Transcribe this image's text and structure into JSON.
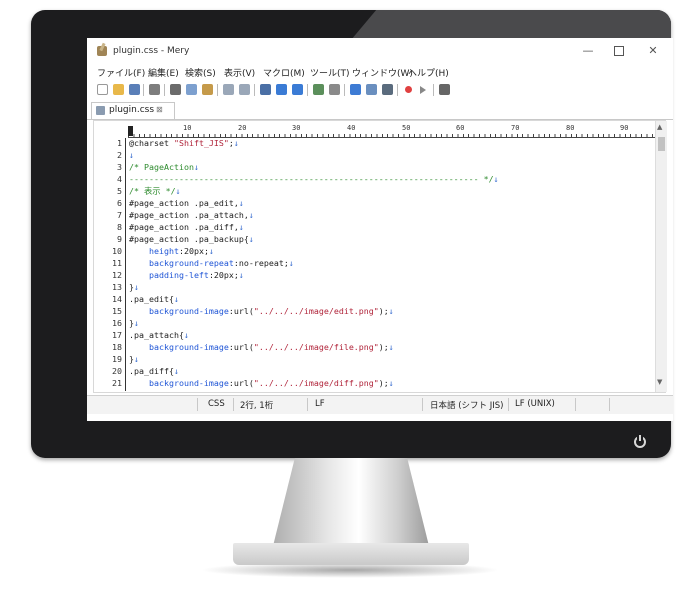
{
  "window": {
    "title": "plugin.css - Mery",
    "min_glyph": "—",
    "close_glyph": "✕"
  },
  "menu": [
    {
      "label": "ファイル(F)"
    },
    {
      "label": "編集(E)"
    },
    {
      "label": "検索(S)"
    },
    {
      "label": "表示(V)"
    },
    {
      "label": "マクロ(M)"
    },
    {
      "label": "ツール(T)"
    },
    {
      "label": "ウィンドウ(W)"
    },
    {
      "label": "ヘルプ(H)"
    }
  ],
  "toolbar": {
    "icons": [
      {
        "name": "new-file-icon",
        "color": "#ffffff"
      },
      {
        "name": "open-folder-icon",
        "color": "#e8b84a"
      },
      {
        "name": "save-icon",
        "color": "#5a7fb8"
      },
      {
        "name": "print-icon",
        "color": "#7d7d7d"
      },
      {
        "name": "cut-icon",
        "color": "#6b6b6b"
      },
      {
        "name": "copy-icon",
        "color": "#7da0cf"
      },
      {
        "name": "paste-icon",
        "color": "#c59a4a"
      },
      {
        "name": "undo-icon",
        "color": "#9aa7b8"
      },
      {
        "name": "redo-icon",
        "color": "#9aa7b8"
      },
      {
        "name": "find-icon",
        "color": "#4a6fa5"
      },
      {
        "name": "find-up-icon",
        "color": "#3a7bd5"
      },
      {
        "name": "find-down-icon",
        "color": "#3a7bd5"
      },
      {
        "name": "replace-icon",
        "color": "#5b8f5b"
      },
      {
        "name": "zoom-icon",
        "color": "#8a8a8a"
      },
      {
        "name": "wrap-icon",
        "color": "#3d7bd4"
      },
      {
        "name": "view-icon",
        "color": "#6a8fbf"
      },
      {
        "name": "panel-icon",
        "color": "#5a6b7d"
      },
      {
        "name": "record-macro-icon",
        "color": "#e04040"
      },
      {
        "name": "play-macro-icon",
        "color": "#888888"
      },
      {
        "name": "settings-icon",
        "color": "#666666"
      }
    ]
  },
  "tab": {
    "label": "plugin.css",
    "close": "⊠"
  },
  "ruler": {
    "marks": [
      "10",
      "20",
      "30",
      "40",
      "50",
      "60",
      "70",
      "80",
      "90"
    ]
  },
  "editor": {
    "lines": [
      {
        "num": "1",
        "tokens": [
          {
            "t": "@charset ",
            "c": "def"
          },
          {
            "t": "\"Shift_JIS\"",
            "c": "str"
          },
          {
            "t": ";",
            "c": "def"
          },
          {
            "t": "↓",
            "c": "mark"
          }
        ]
      },
      {
        "num": "2",
        "tokens": [
          {
            "t": "↓",
            "c": "mark"
          }
        ]
      },
      {
        "num": "3",
        "tokens": [
          {
            "t": "/* PageAction",
            "c": "com"
          },
          {
            "t": "↓",
            "c": "mark"
          }
        ]
      },
      {
        "num": "4",
        "tokens": [
          {
            "t": "---------------------------------------------------------------------- */",
            "c": "com"
          },
          {
            "t": "↓",
            "c": "mark"
          }
        ]
      },
      {
        "num": "5",
        "tokens": [
          {
            "t": "/* 表示 */",
            "c": "com"
          },
          {
            "t": "↓",
            "c": "mark"
          }
        ]
      },
      {
        "num": "6",
        "tokens": [
          {
            "t": "#page_action .pa_edit,",
            "c": "def"
          },
          {
            "t": "↓",
            "c": "mark"
          }
        ]
      },
      {
        "num": "7",
        "tokens": [
          {
            "t": "#page_action .pa_attach,",
            "c": "def"
          },
          {
            "t": "↓",
            "c": "mark"
          }
        ]
      },
      {
        "num": "8",
        "tokens": [
          {
            "t": "#page_action .pa_diff,",
            "c": "def"
          },
          {
            "t": "↓",
            "c": "mark"
          }
        ]
      },
      {
        "num": "9",
        "tokens": [
          {
            "t": "#page_action .pa_backup{",
            "c": "def"
          },
          {
            "t": "↓",
            "c": "mark"
          }
        ]
      },
      {
        "num": "10",
        "tokens": [
          {
            "t": "    ",
            "c": "def"
          },
          {
            "t": "height",
            "c": "prop"
          },
          {
            "t": ":20px;",
            "c": "def"
          },
          {
            "t": "↓",
            "c": "mark"
          }
        ]
      },
      {
        "num": "11",
        "tokens": [
          {
            "t": "    ",
            "c": "def"
          },
          {
            "t": "background-repeat",
            "c": "prop"
          },
          {
            "t": ":no-repeat;",
            "c": "def"
          },
          {
            "t": "↓",
            "c": "mark"
          }
        ]
      },
      {
        "num": "12",
        "tokens": [
          {
            "t": "    ",
            "c": "def"
          },
          {
            "t": "padding-left",
            "c": "prop"
          },
          {
            "t": ":20px;",
            "c": "def"
          },
          {
            "t": "↓",
            "c": "mark"
          }
        ]
      },
      {
        "num": "13",
        "tokens": [
          {
            "t": "}",
            "c": "def"
          },
          {
            "t": "↓",
            "c": "mark"
          }
        ]
      },
      {
        "num": "14",
        "tokens": [
          {
            "t": ".pa_edit{",
            "c": "def"
          },
          {
            "t": "↓",
            "c": "mark"
          }
        ]
      },
      {
        "num": "15",
        "tokens": [
          {
            "t": "    ",
            "c": "def"
          },
          {
            "t": "background-image",
            "c": "prop"
          },
          {
            "t": ":url(",
            "c": "def"
          },
          {
            "t": "\"../../../image/edit.png\"",
            "c": "str"
          },
          {
            "t": ");",
            "c": "def"
          },
          {
            "t": "↓",
            "c": "mark"
          }
        ]
      },
      {
        "num": "16",
        "tokens": [
          {
            "t": "}",
            "c": "def"
          },
          {
            "t": "↓",
            "c": "mark"
          }
        ]
      },
      {
        "num": "17",
        "tokens": [
          {
            "t": ".pa_attach{",
            "c": "def"
          },
          {
            "t": "↓",
            "c": "mark"
          }
        ]
      },
      {
        "num": "18",
        "tokens": [
          {
            "t": "    ",
            "c": "def"
          },
          {
            "t": "background-image",
            "c": "prop"
          },
          {
            "t": ":url(",
            "c": "def"
          },
          {
            "t": "\"../../../image/file.png\"",
            "c": "str"
          },
          {
            "t": ");",
            "c": "def"
          },
          {
            "t": "↓",
            "c": "mark"
          }
        ]
      },
      {
        "num": "19",
        "tokens": [
          {
            "t": "}",
            "c": "def"
          },
          {
            "t": "↓",
            "c": "mark"
          }
        ]
      },
      {
        "num": "20",
        "tokens": [
          {
            "t": ".pa_diff{",
            "c": "def"
          },
          {
            "t": "↓",
            "c": "mark"
          }
        ]
      },
      {
        "num": "21",
        "tokens": [
          {
            "t": "    ",
            "c": "def"
          },
          {
            "t": "background-image",
            "c": "prop"
          },
          {
            "t": ":url(",
            "c": "def"
          },
          {
            "t": "\"../../../image/diff.png\"",
            "c": "str"
          },
          {
            "t": ");",
            "c": "def"
          },
          {
            "t": "↓",
            "c": "mark"
          }
        ]
      }
    ]
  },
  "status": {
    "language": "CSS",
    "position": "2行, 1桁",
    "newline": "LF",
    "encoding": "日本語 (シフト JIS)",
    "line_ending": "LF (UNIX)"
  }
}
